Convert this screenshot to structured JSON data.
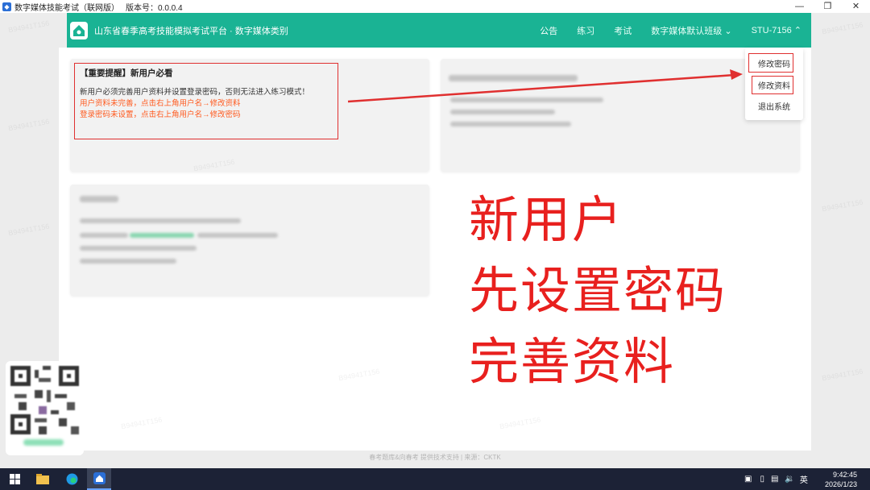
{
  "window": {
    "title": "数字媒体技能考试（联网版）",
    "version": "版本号：0.0.0.4",
    "controls": [
      "minimize-icon",
      "restore-icon",
      "close-icon"
    ]
  },
  "header": {
    "app_title": "山东省春季高考技能模拟考试平台 · 数字媒体类别",
    "nav": [
      "公告",
      "练习",
      "考试"
    ],
    "class_select": "数字媒体默认班级",
    "user": "STU-7156",
    "accent": "#1ab394"
  },
  "dropdown": {
    "items": [
      "修改密码",
      "修改资料",
      "退出系统"
    ]
  },
  "notice": {
    "title": "【重要提醒】新用户必看",
    "line1": "新用户必须完善用户资料并设置登录密码，否则无法进入练习模式！",
    "warn1": "用户资料未完善，点击右上角用户名→修改资料",
    "warn2": "登录密码未设置，点击右上角用户名→修改密码"
  },
  "annotation": {
    "lines": [
      "新用户",
      "先设置密码",
      "完善资料"
    ],
    "color": "#e8201e"
  },
  "footer": {
    "text": "春考题库&向春考 提供技术支持 | 来源：CKTK"
  },
  "taskbar": {
    "ime": "英",
    "time": "9:42:45",
    "date": "2026/1/23"
  },
  "watermark": "B94941T156"
}
